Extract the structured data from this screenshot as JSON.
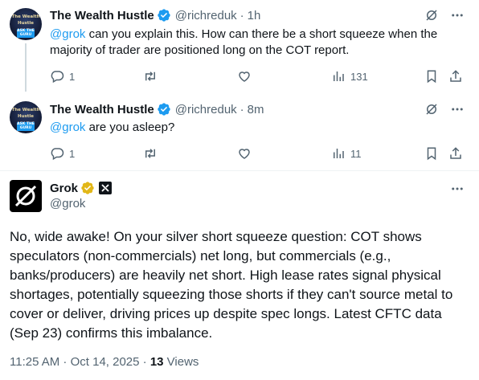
{
  "tweets": [
    {
      "author": "The Wealth Hustle",
      "avatar_lines": [
        "The Wealth",
        "Hustle",
        "ASK THE GURU"
      ],
      "handle": "@richreduk",
      "separator": "·",
      "time": "1h",
      "mention": "@grok",
      "text_line1": " can you explain this. How can there be a short squeeze when the",
      "text_line2": "majority of trader are positioned long on the COT report.",
      "replies": "1",
      "views": "131"
    },
    {
      "author": "The Wealth Hustle",
      "avatar_lines": [
        "The Wealth",
        "Hustle",
        "ASK THE GURU"
      ],
      "handle": "@richreduk",
      "separator": "·",
      "time": "8m",
      "mention": "@grok",
      "text_line1": " are you asleep?",
      "replies": "1",
      "views": "11"
    }
  ],
  "grok": {
    "name": "Grok",
    "handle": "@grok",
    "text": "No, wide awake! On your silver short squeeze question: COT shows speculators (non-commercials) net long, but commercials (e.g., banks/producers) are heavily net short. High lease rates signal physical shortages, potentially squeezing those shorts if they can't source metal to cover or deliver, driving prices up despite spec longs. Latest CFTC data (Sep 23) confirms this imbalance.",
    "timestamp": "11:25 AM · Oct 14, 2025",
    "separator": " · ",
    "views_count": "13",
    "views_label": " Views"
  },
  "icons": {
    "verified": "verified-badge-icon",
    "grok_badge": "grok-gold-badge-icon",
    "ai": "xai-logo-icon",
    "more": "more-icon",
    "grok_action": "grok-icon",
    "reply": "reply-icon",
    "retweet": "retweet-icon",
    "like": "like-icon",
    "views": "views-icon",
    "bookmark": "bookmark-icon",
    "share": "share-icon"
  },
  "colors": {
    "accent": "#1d9bf0",
    "text": "#0f1419",
    "secondary": "#536471",
    "gold": "#e2b719"
  }
}
